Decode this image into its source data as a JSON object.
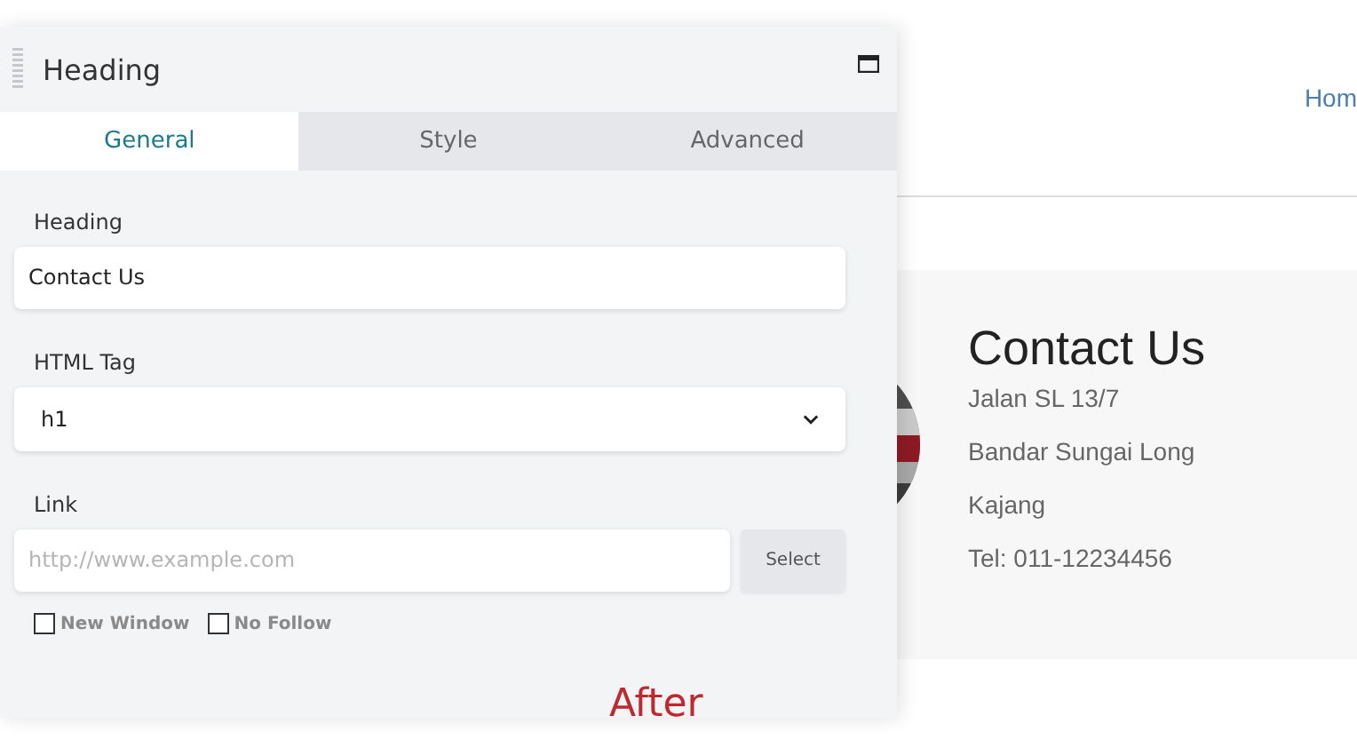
{
  "site": {
    "nav": [
      {
        "label": "Hom"
      }
    ],
    "contact": {
      "title": "Contact Us",
      "lines": [
        "Jalan SL 13/7",
        "Bandar Sungai Long",
        "Kajang",
        "Tel: 011-12234456"
      ]
    }
  },
  "panel": {
    "title": "Heading",
    "tabs": [
      {
        "label": "General",
        "selected": true
      },
      {
        "label": "Style",
        "selected": false
      },
      {
        "label": "Advanced",
        "selected": false
      }
    ],
    "fields": [
      {
        "kind": "text",
        "label": "Heading",
        "value": "Contact Us"
      },
      {
        "kind": "select",
        "label": "HTML Tag",
        "value": "h1"
      },
      {
        "kind": "link",
        "label": "Link",
        "placeholder": "http://www.example.com",
        "button": "Select"
      }
    ],
    "options": [
      {
        "label": "New Window",
        "checked": false
      },
      {
        "label": "No Follow",
        "checked": false
      }
    ]
  },
  "caption": "After"
}
